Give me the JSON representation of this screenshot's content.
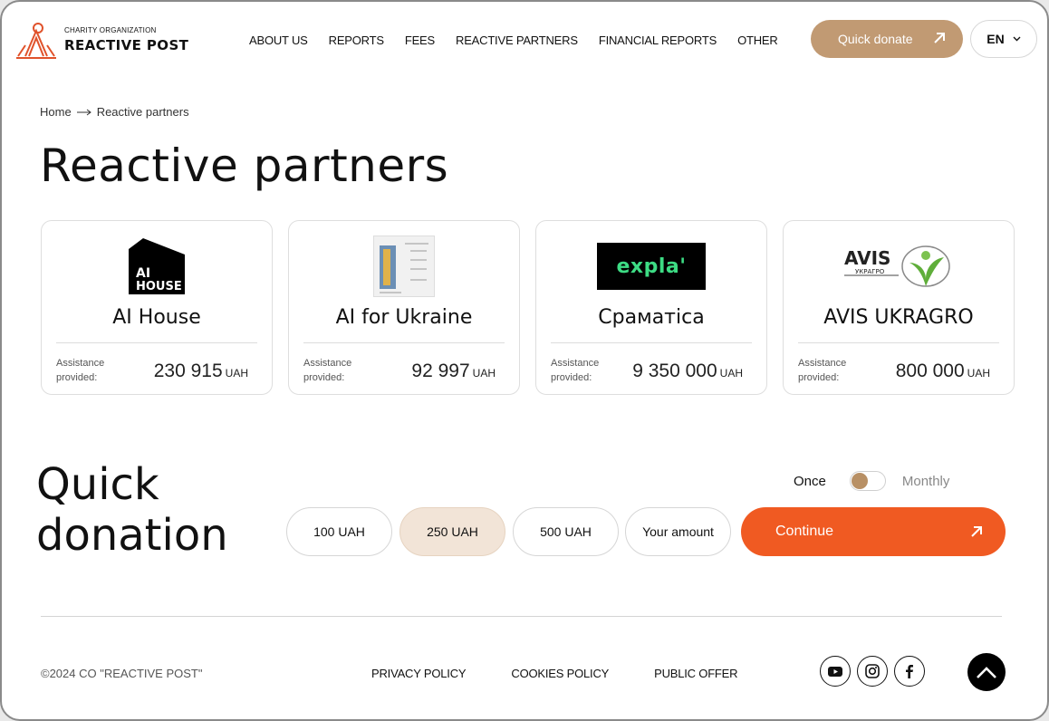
{
  "header": {
    "logo_small": "CHARITY ORGANIZATION",
    "logo_big": "REACTIVE POST",
    "nav": [
      "ABOUT US",
      "REPORTS",
      "FEES",
      "REACTIVE PARTNERS",
      "FINANCIAL REPORTS",
      "OTHER"
    ],
    "quick_donate": "Quick donate",
    "language": "EN"
  },
  "breadcrumb": {
    "home": "Home",
    "current": "Reactive partners"
  },
  "page_title": "Reactive partners",
  "partners": [
    {
      "name": "AI House",
      "assist_label": "Assistance provided:",
      "amount": "230 915",
      "currency": "UAH",
      "logo": "aihouse-logo",
      "logo_text_1": "AI",
      "logo_text_2": "HOUSE"
    },
    {
      "name": "AI for Ukraine",
      "assist_label": "Assistance provided:",
      "amount": "92 997",
      "currency": "UAH",
      "logo": "poster-logo"
    },
    {
      "name": "Cpaматica",
      "assist_label": "Assistance provided:",
      "amount": "9 350 000",
      "currency": "UAH",
      "logo": "explaa-logo",
      "logo_text": "expla'"
    },
    {
      "name": "AVIS UKRAGRO",
      "assist_label": "Assistance provided:",
      "amount": "800 000",
      "currency": "UAH",
      "logo": "avis-logo",
      "logo_text": "AVIS",
      "logo_sub": "УКРАГРО"
    }
  ],
  "quick_donation": {
    "title_line1": "Quick",
    "title_line2": "donation",
    "once": "Once",
    "monthly": "Monthly",
    "amounts": [
      "100 UAH",
      "250 UAH",
      "500 UAH",
      "Your amount"
    ],
    "selected_index": 1,
    "continue": "Continue"
  },
  "footer": {
    "copyright": "©2024 CO \"REACTIVE POST\"",
    "links": [
      "PRIVACY POLICY",
      "COOKIES POLICY",
      "PUBLIC OFFER"
    ],
    "socials": [
      "youtube-icon",
      "instagram-icon",
      "facebook-icon"
    ]
  },
  "colors": {
    "accent_tan": "#c19a73",
    "accent_orange": "#f05a22",
    "selected_bg": "#f2e4d7"
  }
}
